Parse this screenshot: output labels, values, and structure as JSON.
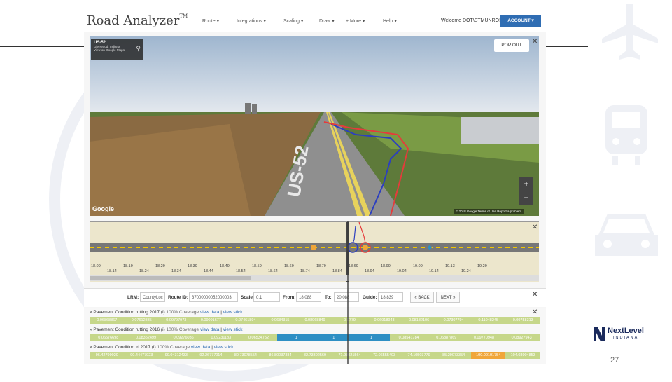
{
  "slide": {
    "page_number": "27"
  },
  "next_level_logo": {
    "name": "NextLevel",
    "sub": "INDIANA"
  },
  "app": {
    "title": "Road Analyzer",
    "tm": "TM",
    "nav": [
      "Route ▾",
      "Integrations ▾",
      "Scaling ▾",
      "Draw ▾",
      "+ More ▾",
      "Help ▾"
    ],
    "welcome": "Welcome DOT\\STMUNRO!",
    "account_label": "ACCOUNT ▾"
  },
  "streetview": {
    "road": "US-52",
    "location": "Glenwood, Indiana",
    "google_maps_link": "View on Google Maps",
    "popout_label": "POP OUT",
    "google_logo": "Google",
    "footer": "© 2018 Google   Terms of Use   Report a problem",
    "road_marking": "US-52"
  },
  "strip_map": {
    "tick_labels": [
      "18.09",
      "18.19",
      "18.29",
      "18.39",
      "18.49",
      "18.59",
      "18.69",
      "18.79",
      "18.69",
      "18.99",
      "19.09",
      "19.13",
      "19.29",
      "18.14",
      "18.24",
      "18.34",
      "18.44",
      "18.54",
      "18.64",
      "18.74",
      "18.84",
      "18.94",
      "19.04",
      "19.14",
      "19.24"
    ]
  },
  "controls": {
    "lrm_label": "LRM:",
    "lrm_value": "CountyLoc",
    "route_id_label": "Route ID:",
    "route_id_value": "37000000052000003",
    "scale_label": "Scale:",
    "scale_value": "0.1",
    "from_label": "From:",
    "from_value": "18.088",
    "to_label": "To:",
    "to_value": "20.088",
    "guide_label": "Guide:",
    "guide_value": "18.839",
    "back_label": "« BACK",
    "next_label": "NEXT »"
  },
  "data_rows": [
    {
      "title": "» Pavement Condition rutting 2017 (i)",
      "coverage": "100% Coverage",
      "view_data": "view data",
      "view_stick": "view stick",
      "values": [
        "0.06868867",
        "0.07612835",
        "0.09797973",
        "0.09091677",
        "0.07461894",
        "0.0684315",
        "0.08968849",
        "0.0779",
        "0.06918943",
        "0.08182106",
        "0.07307794",
        "0.11048245",
        "0.09758313"
      ]
    },
    {
      "title": "» Pavement Condition rutting 2016 (i)",
      "coverage": "100% Coverage",
      "view_data": "view data",
      "view_stick": "view stick",
      "values": [
        "0.06576698",
        "0.08352499",
        "0.09276036",
        "0.09231183",
        "0.06534752",
        "1",
        "1",
        "1",
        "0.08541784",
        "0.06887869",
        "0.09770948",
        "0.08927943"
      ]
    },
    {
      "title": "» Pavement Condition iri 2017 (i)",
      "coverage": "100% Coverage",
      "view_data": "view data",
      "view_stick": "view stick",
      "values": [
        "96.42799020",
        "90.44477923",
        "99.04312433",
        "92.26777014",
        "80.73078554",
        "86.80037384",
        "82.73302569",
        "71.93021564",
        "72.06555403",
        "74.10503779",
        "85.29073354",
        "100.00101754",
        "104.03904853"
      ]
    }
  ],
  "colors": {
    "accent": "#2f6db3",
    "data_green": "#c6d78a",
    "data_blue": "#2e8fc4",
    "data_orange": "#f0a63a",
    "trace_red": "#e53b3b",
    "trace_blue": "#2c3fbf"
  }
}
